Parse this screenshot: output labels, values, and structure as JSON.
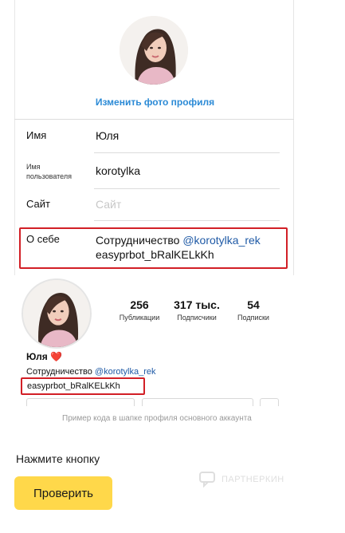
{
  "edit_profile": {
    "change_photo_label": "Изменить фото профиля",
    "fields": {
      "name": {
        "label": "Имя",
        "value": "Юля"
      },
      "username": {
        "label_line1": "Имя",
        "label_line2": "пользователя",
        "value": "korotylka"
      },
      "website": {
        "label": "Сайт",
        "placeholder": "Сайт"
      },
      "bio": {
        "label": "О себе",
        "line1_prefix": "Сотрудничество ",
        "line1_mention": "@korotylka_rek",
        "line2": "easyprbot_bRalKELkKh"
      }
    }
  },
  "profile_example": {
    "stats": [
      {
        "number": "256",
        "label": "Публикации"
      },
      {
        "number": "317 тыс.",
        "label": "Подписчики"
      },
      {
        "number": "54",
        "label": "Подписки"
      }
    ],
    "name": "Юля",
    "heart": "❤️",
    "bio_prefix": "Сотрудничество ",
    "bio_mention": "@korotylka_rek",
    "bio_code": "easyprbot_bRalKELkKh",
    "caption": "Пример кода в шапке профиля основного аккаунта"
  },
  "cta": {
    "label": "Нажмите кнопку",
    "button_label": "Проверить"
  },
  "watermark": {
    "text": "ПАРТНЕРКИН"
  },
  "colors": {
    "link_blue": "#2b8ad6",
    "mention_blue": "#1f5aa6",
    "highlight_red": "#d21f26",
    "button_yellow": "#ffd84a"
  }
}
